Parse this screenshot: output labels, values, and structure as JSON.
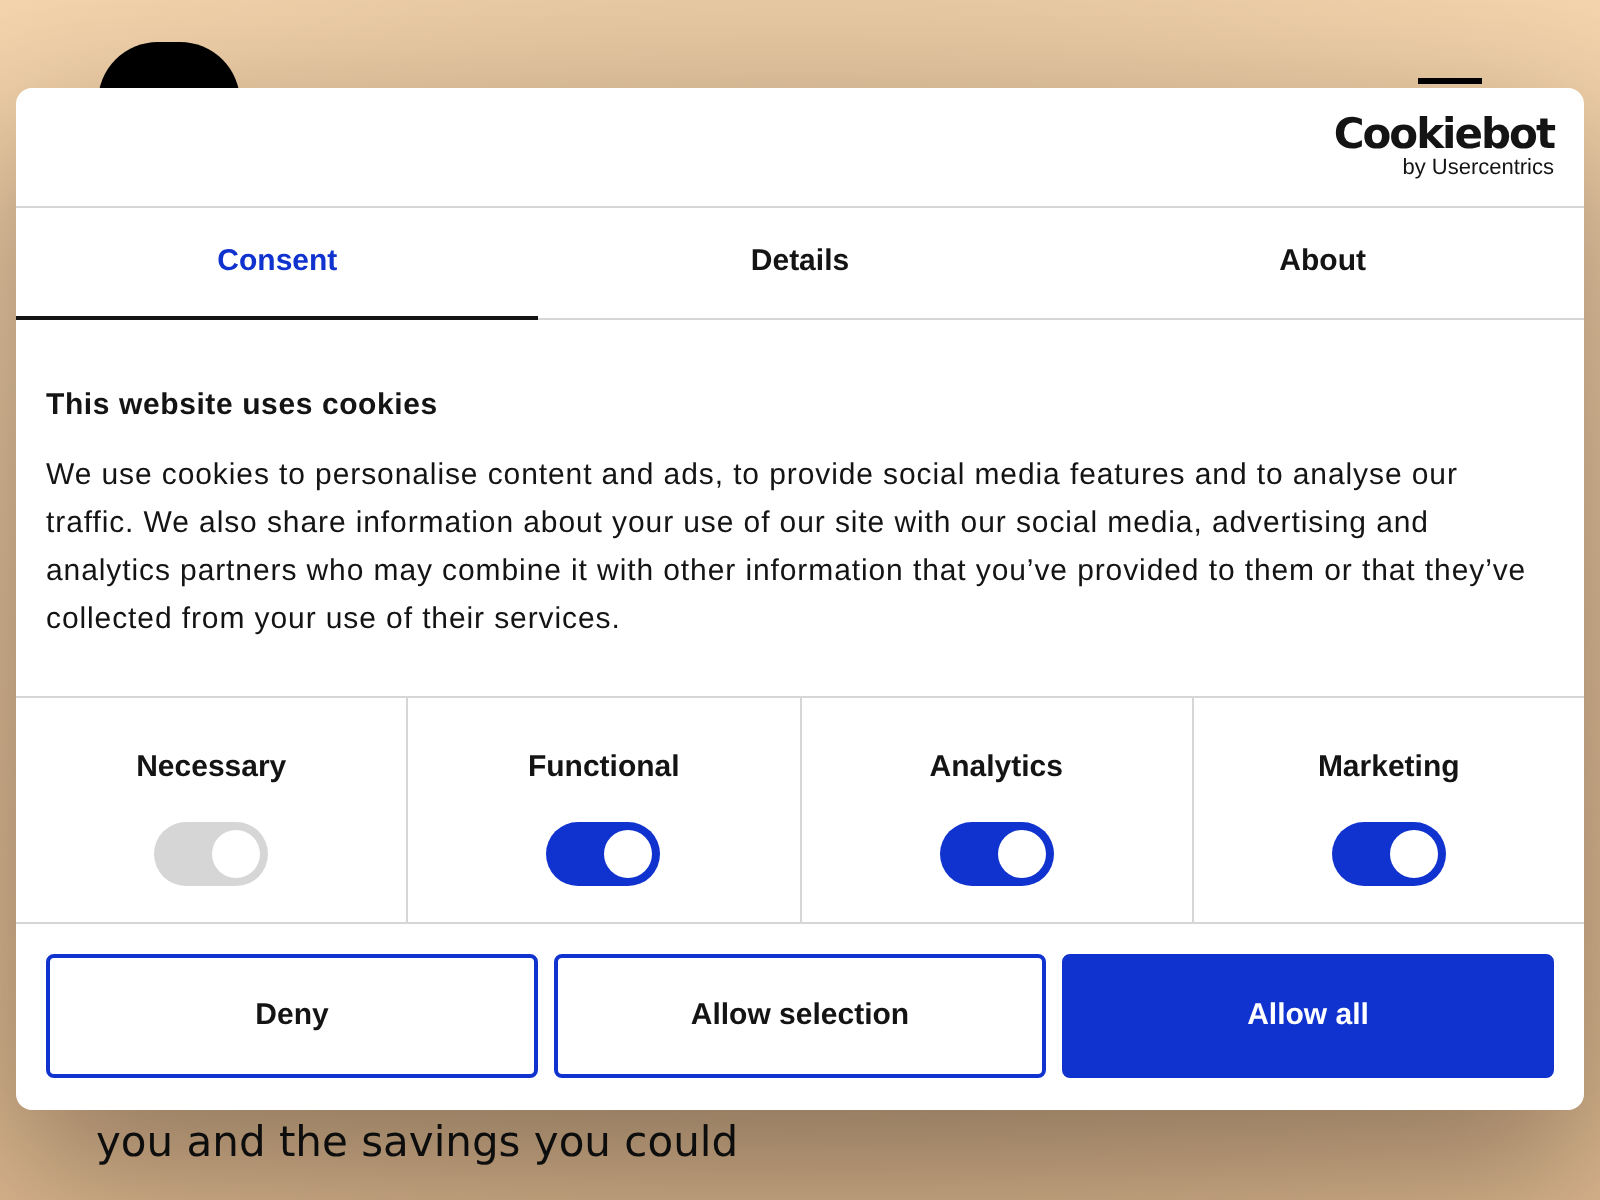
{
  "background_page": {
    "text_lines": [
      "you and the savings you could"
    ]
  },
  "dialog": {
    "brand": {
      "name": "Cookiebot",
      "tagline": "by Usercentrics"
    },
    "tabs": [
      {
        "label": "Consent",
        "selected": true
      },
      {
        "label": "Details",
        "selected": false
      },
      {
        "label": "About",
        "selected": false
      }
    ],
    "heading": "This website uses cookies",
    "body": "We use cookies to personalise content and ads, to provide social media features and to analyse our traffic. We also share information about your use of our site with our social media, advertising and analytics partners who may combine it with other information that you’ve provided to them or that they’ve collected from your use of their services.",
    "categories": [
      {
        "label": "Necessary",
        "on": true,
        "disabled": true
      },
      {
        "label": "Functional",
        "on": true,
        "disabled": false
      },
      {
        "label": "Analytics",
        "on": true,
        "disabled": false
      },
      {
        "label": "Marketing",
        "on": true,
        "disabled": false
      }
    ],
    "buttons": [
      {
        "label": "Deny",
        "kind": "outline"
      },
      {
        "label": "Allow selection",
        "kind": "outline"
      },
      {
        "label": "Allow all",
        "kind": "primary"
      }
    ]
  }
}
